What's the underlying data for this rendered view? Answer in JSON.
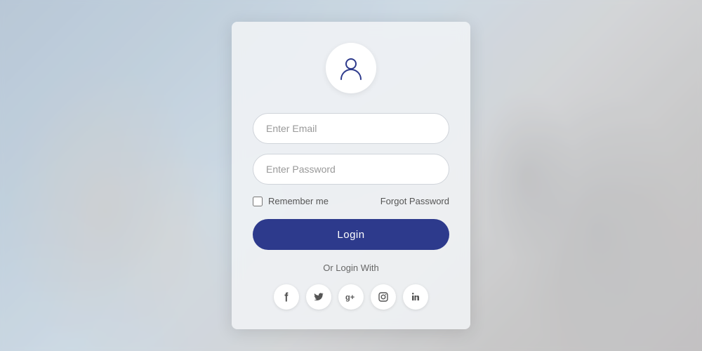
{
  "background": {
    "alt": "Blurred classroom background"
  },
  "card": {
    "avatar_icon": "user-icon",
    "email_placeholder": "Enter Email",
    "password_placeholder": "Enter Password",
    "remember_label": "Remember me",
    "forgot_label": "Forgot Password",
    "login_label": "Login",
    "or_text": "Or Login With",
    "social": [
      {
        "id": "facebook",
        "label": "f",
        "name": "facebook-icon"
      },
      {
        "id": "twitter",
        "label": "t",
        "name": "twitter-icon"
      },
      {
        "id": "google",
        "label": "g+",
        "name": "google-icon"
      },
      {
        "id": "instagram",
        "label": "in",
        "name": "instagram-icon"
      },
      {
        "id": "linkedin",
        "label": "in",
        "name": "linkedin-icon"
      }
    ]
  },
  "colors": {
    "brand": "#2d3a8c",
    "brand_light": "#3d4b9e"
  }
}
